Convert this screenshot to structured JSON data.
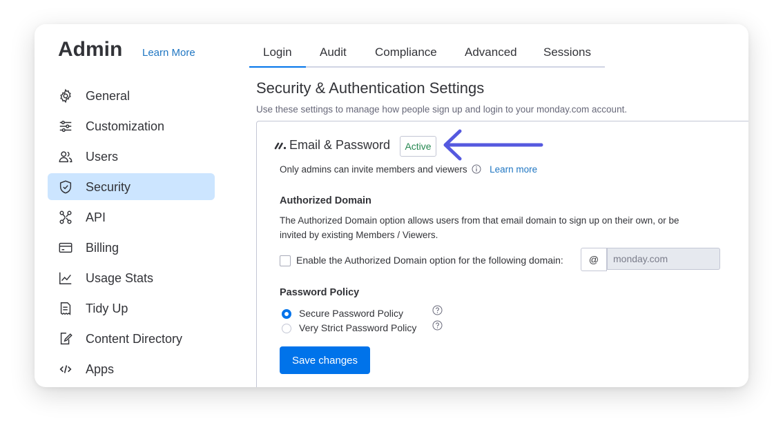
{
  "header": {
    "title": "Admin",
    "learn_more": "Learn More"
  },
  "sidebar": {
    "items": [
      {
        "label": "General",
        "icon": "gear-icon"
      },
      {
        "label": "Customization",
        "icon": "sliders-icon"
      },
      {
        "label": "Users",
        "icon": "users-icon"
      },
      {
        "label": "Security",
        "icon": "shield-icon",
        "active": true
      },
      {
        "label": "API",
        "icon": "api-nodes-icon"
      },
      {
        "label": "Billing",
        "icon": "credit-card-icon"
      },
      {
        "label": "Usage Stats",
        "icon": "line-chart-icon"
      },
      {
        "label": "Tidy Up",
        "icon": "receipt-icon"
      },
      {
        "label": "Content Directory",
        "icon": "document-edit-icon"
      },
      {
        "label": "Apps",
        "icon": "code-icon"
      }
    ]
  },
  "tabs": [
    {
      "label": "Login",
      "active": true
    },
    {
      "label": "Audit"
    },
    {
      "label": "Compliance"
    },
    {
      "label": "Advanced"
    },
    {
      "label": "Sessions"
    }
  ],
  "main": {
    "title": "Security & Authentication Settings",
    "description": "Use these settings to manage how people sign up and login to your monday.com account.",
    "panel": {
      "heading": "Email & Password",
      "badge": "Active",
      "invite_note": "Only admins can invite members and viewers",
      "learn_more": "Learn more",
      "authorized_domain": {
        "title": "Authorized Domain",
        "description": "The Authorized Domain option allows users from that email domain to sign up on their own, or be invited by existing Members / Viewers.",
        "checkbox_label": "Enable the Authorized Domain option for the following domain:",
        "checked": false,
        "at_symbol": "@",
        "placeholder": "monday.com"
      },
      "password_policy": {
        "title": "Password Policy",
        "options": [
          {
            "label": "Secure Password Policy",
            "selected": true
          },
          {
            "label": "Very Strict Password Policy",
            "selected": false
          }
        ]
      },
      "save_label": "Save changes"
    }
  },
  "colors": {
    "accent": "#0073ea",
    "active_nav_bg": "#cce5ff",
    "badge_text": "#258750",
    "arrow": "#5559df",
    "link": "#1f76c2"
  }
}
